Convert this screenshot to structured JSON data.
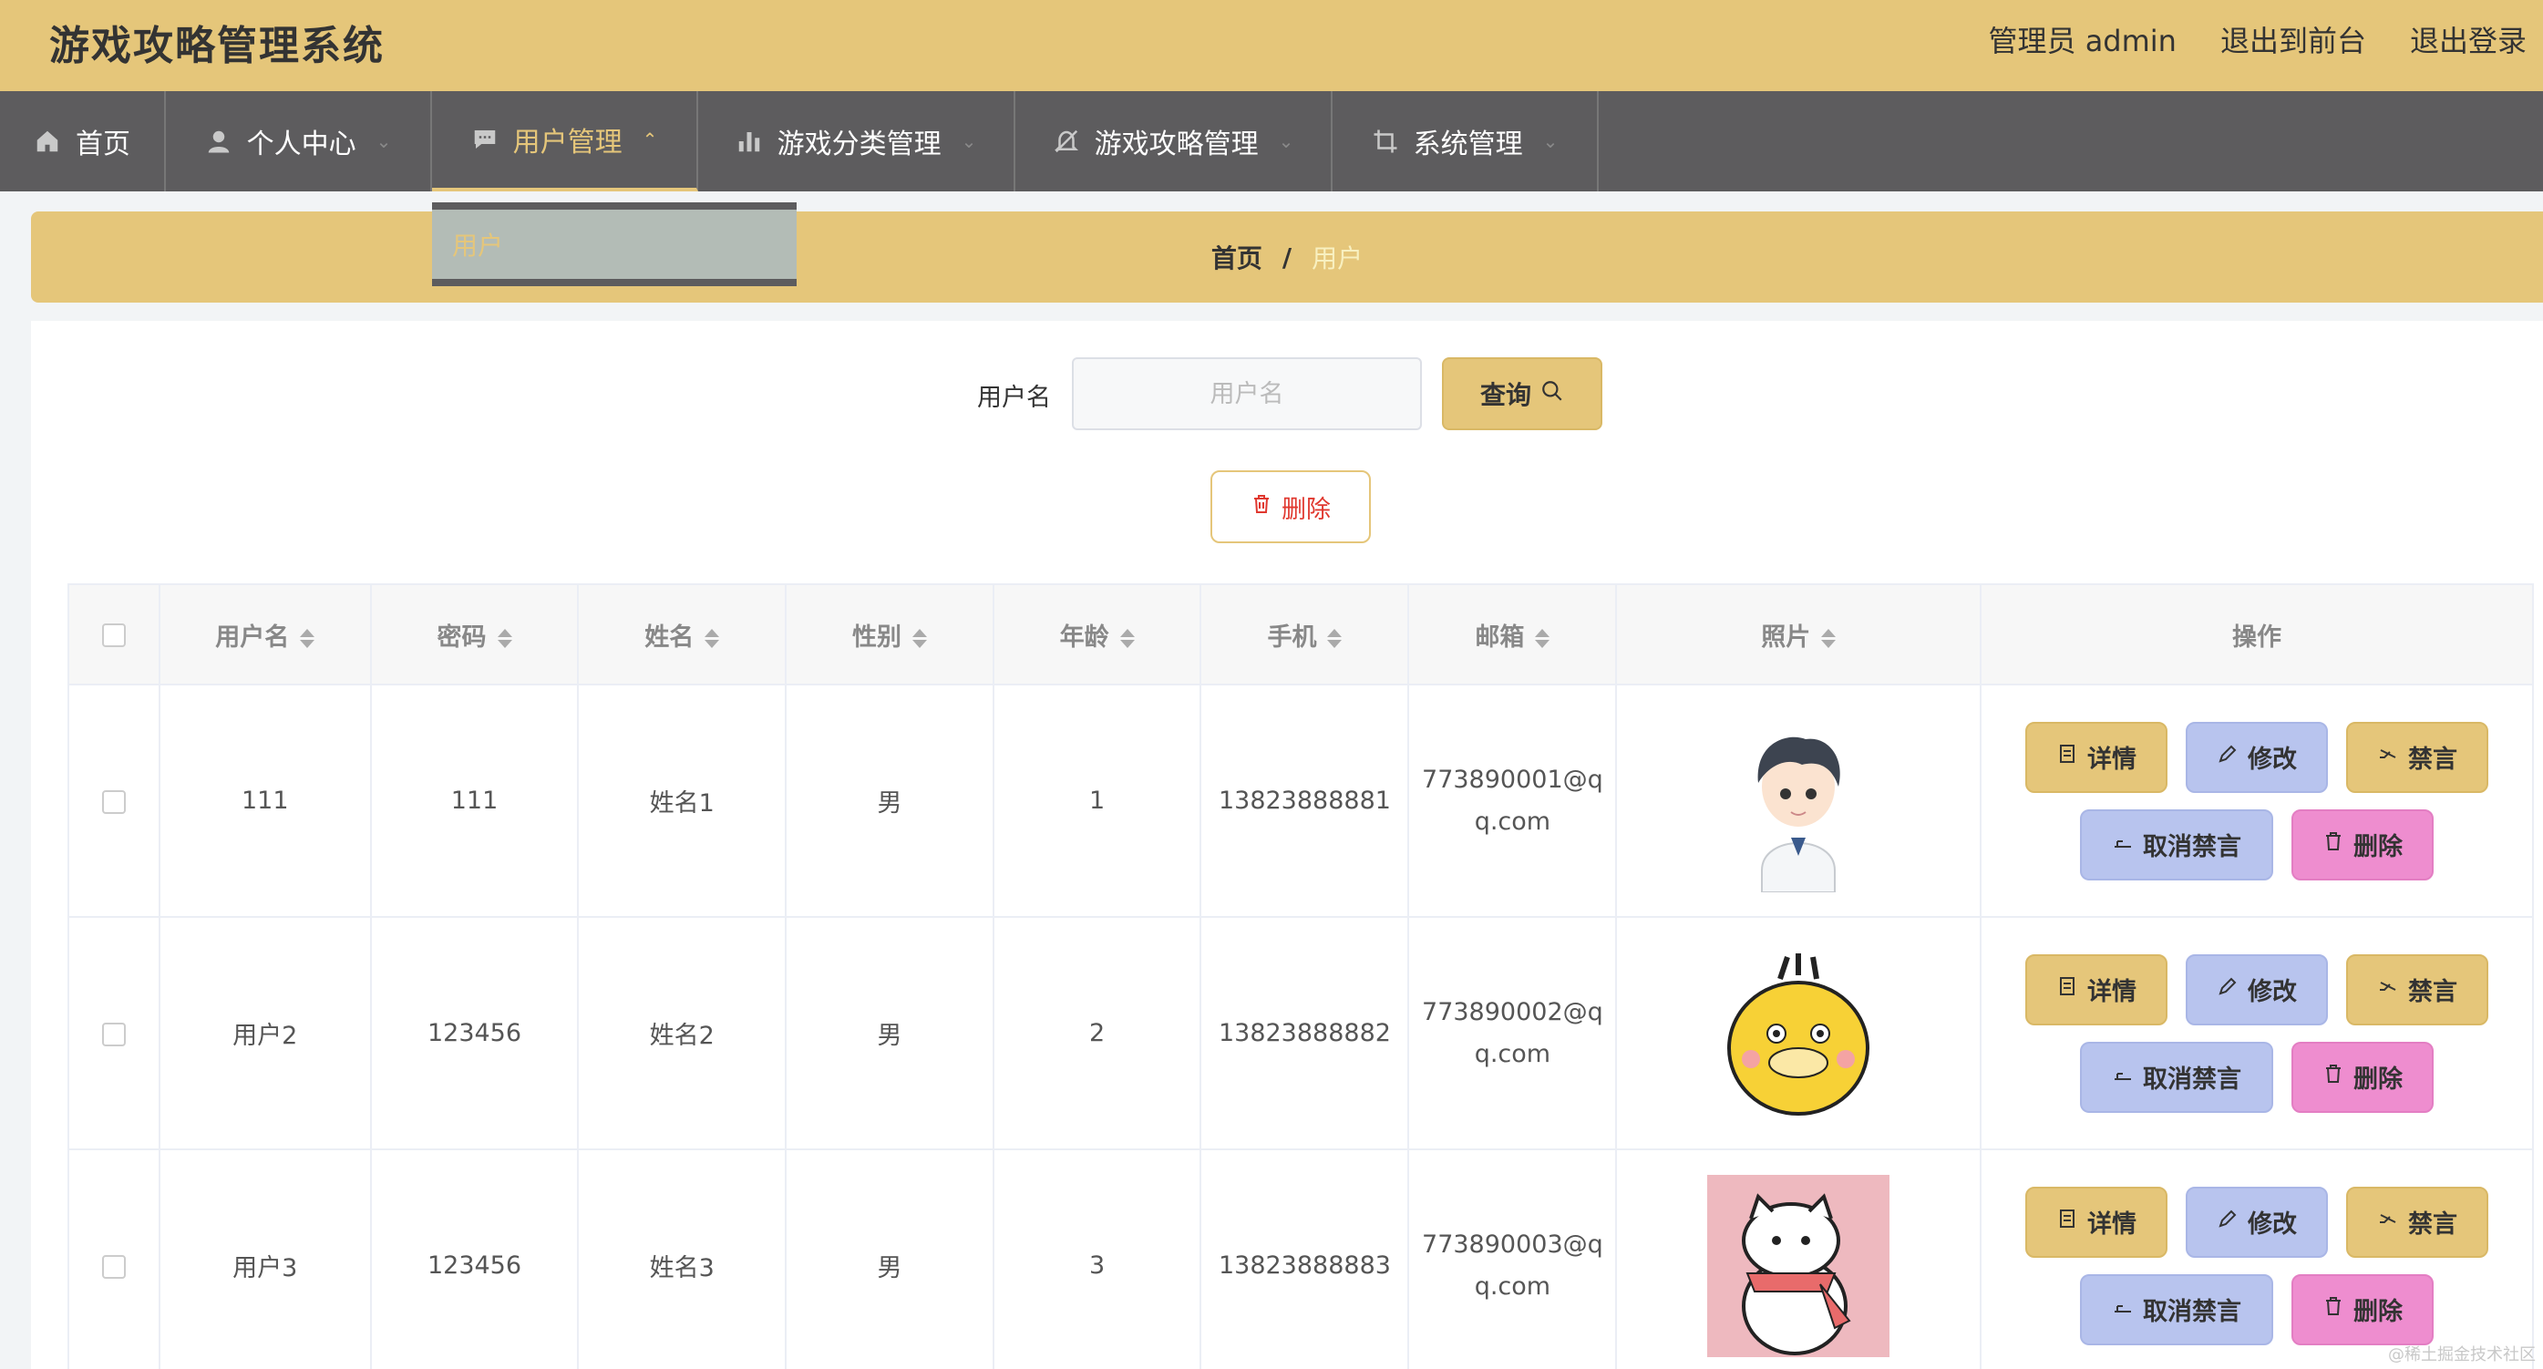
{
  "header": {
    "title": "游戏攻略管理系统",
    "admin_label": "管理员 admin",
    "back_front": "退出到前台",
    "logout": "退出登录"
  },
  "nav": {
    "items": [
      {
        "label": "首页",
        "icon": "home-icon"
      },
      {
        "label": "个人中心",
        "icon": "user-icon"
      },
      {
        "label": "用户管理",
        "icon": "chat-icon",
        "active": true
      },
      {
        "label": "游戏分类管理",
        "icon": "bar-chart-icon"
      },
      {
        "label": "游戏攻略管理",
        "icon": "bell-off-icon"
      },
      {
        "label": "系统管理",
        "icon": "crop-icon"
      }
    ],
    "dropdown": {
      "item": "用户"
    }
  },
  "breadcrumb": {
    "home": "首页",
    "sep": "/",
    "current": "用户"
  },
  "search": {
    "label": "用户名",
    "placeholder": "用户名",
    "button": "查询"
  },
  "actions": {
    "delete": "删除"
  },
  "table": {
    "columns": [
      "用户名",
      "密码",
      "姓名",
      "性别",
      "年龄",
      "手机",
      "邮箱",
      "照片",
      "操作"
    ],
    "rows": [
      {
        "username": "111",
        "password": "111",
        "name": "姓名1",
        "gender": "男",
        "age": "1",
        "phone": "13823888881",
        "email": "773890001@qq.com",
        "photo": "boy-avatar"
      },
      {
        "username": "用户2",
        "password": "123456",
        "name": "姓名2",
        "gender": "男",
        "age": "2",
        "phone": "13823888882",
        "email": "773890002@qq.com",
        "photo": "duck-avatar"
      },
      {
        "username": "用户3",
        "password": "123456",
        "name": "姓名3",
        "gender": "男",
        "age": "3",
        "phone": "13823888883",
        "email": "773890003@qq.com",
        "photo": "cat-avatar"
      }
    ],
    "ops": {
      "detail": "详情",
      "edit": "修改",
      "ban": "禁言",
      "unban": "取消禁言",
      "delete": "删除"
    }
  },
  "watermark": "@稀土掘金技术社区",
  "colors": {
    "accent": "#e5c67a",
    "nav_bg": "#5d5c5e",
    "edit_btn": "#b8c4ee",
    "delete_btn": "#ee8dcf",
    "danger_text": "#e0382f"
  }
}
